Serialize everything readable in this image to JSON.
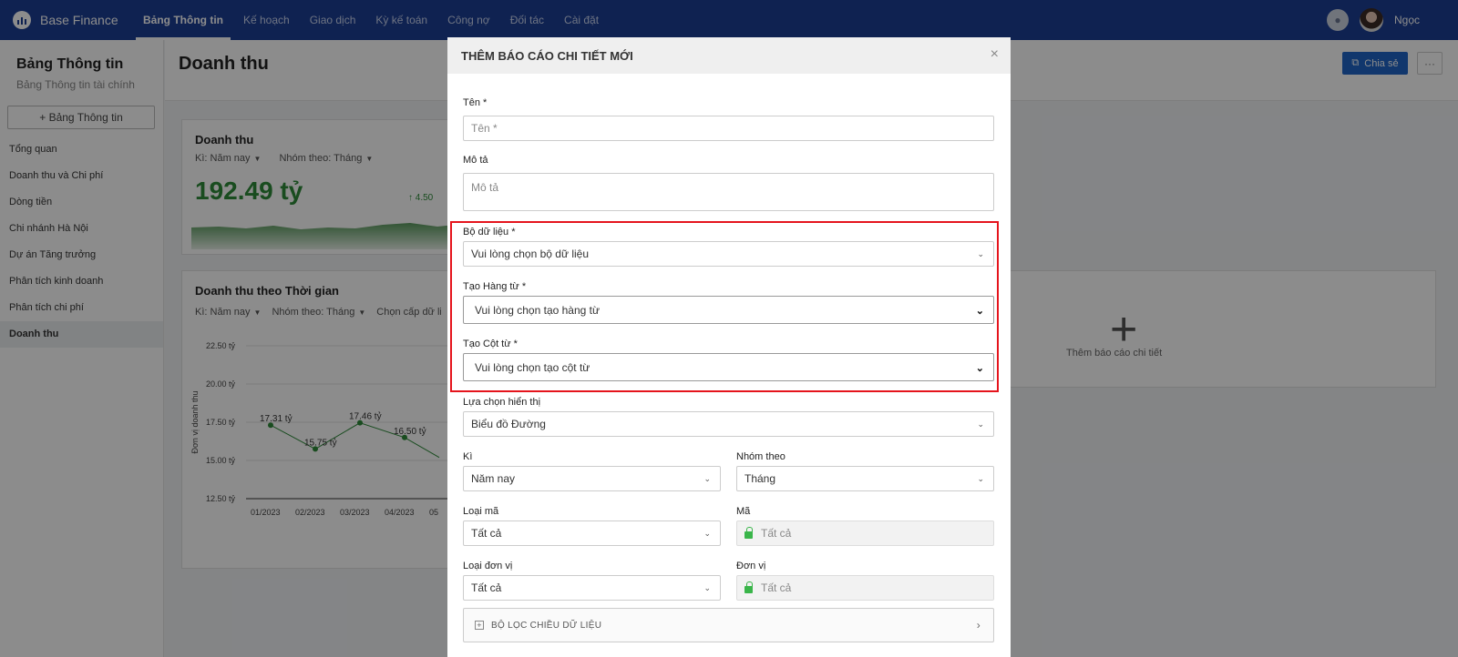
{
  "topnav": {
    "brand": "Base Finance",
    "items": [
      "Bảng Thông tin",
      "Kế hoạch",
      "Giao dịch",
      "Kỳ kế toán",
      "Công nợ",
      "Đối tác",
      "Cài đặt"
    ],
    "user": "Ngọc"
  },
  "sidebar": {
    "title": "Bảng Thông tin",
    "subtitle": "Bảng Thông tin tài chính",
    "add_button": "+ Bảng Thông tin",
    "items": [
      "Tổng quan",
      "Doanh thu và Chi phí",
      "Dòng tiền",
      "Chi nhánh Hà Nội",
      "Dự án Tăng trưởng",
      "Phân tích kinh doanh",
      "Phân tích chi phí",
      "Doanh thu"
    ]
  },
  "main": {
    "page_title": "Doanh thu",
    "share_label": "Chia sẻ",
    "more_label": "···",
    "kpi_card": {
      "title": "Doanh thu",
      "period": "Kì: Năm nay",
      "group": "Nhóm theo: Tháng",
      "value": "192.49 tỷ",
      "change": "↑ 4.50"
    },
    "time_card": {
      "title": "Doanh thu theo Thời gian",
      "period": "Kì: Năm nay",
      "group": "Nhóm theo: Tháng",
      "level": "Chọn cấp dữ liệu"
    },
    "add_card_label": "Thêm báo cáo chi tiết"
  },
  "chart_data": {
    "type": "line",
    "ylabel": "Đơn vị doanh thu",
    "y_ticks": [
      "22.50 tỷ",
      "20.00 tỷ",
      "17.50 tỷ",
      "15.00 tỷ",
      "12.50 tỷ"
    ],
    "ylim": [
      12.5,
      22.5
    ],
    "x": [
      "01/2023",
      "02/2023",
      "03/2023",
      "04/2023",
      "05"
    ],
    "values": [
      17.31,
      15.75,
      17.46,
      16.5
    ],
    "labels": [
      "17.31 tỷ",
      "15.75 tỷ",
      "17.46 tỷ",
      "16.50 tỷ"
    ],
    "line_color": "#2e8b3a"
  },
  "modal": {
    "title": "THÊM BÁO CÁO CHI TIẾT MỚI",
    "close": "×",
    "name_label": "Tên *",
    "name_placeholder": "Tên *",
    "desc_label": "Mô tả",
    "desc_placeholder": "Mô tả",
    "dataset_label": "Bộ dữ liệu *",
    "dataset_value": "Vui lòng chọn bộ dữ liệu",
    "rows_label": "Tạo Hàng từ *",
    "rows_value": "Vui lòng chọn tạo hàng từ",
    "cols_label": "Tạo Cột từ *",
    "cols_value": "Vui lòng chọn tạo cột từ",
    "display_label": "Lựa chọn hiển thị",
    "display_value": "Biểu đồ Đường",
    "period_label": "Kì",
    "period_value": "Năm nay",
    "group_label": "Nhóm theo",
    "group_value": "Tháng",
    "code_type_label": "Loại mã",
    "code_type_value": "Tất cả",
    "code_label": "Mã",
    "code_value": "Tất cả",
    "unit_type_label": "Loại đơn vị",
    "unit_type_value": "Tất cả",
    "unit_label": "Đơn vị",
    "unit_value": "Tất cả",
    "filter_bar": "BỘ LỌC CHIỀU DỮ LIỆU"
  }
}
